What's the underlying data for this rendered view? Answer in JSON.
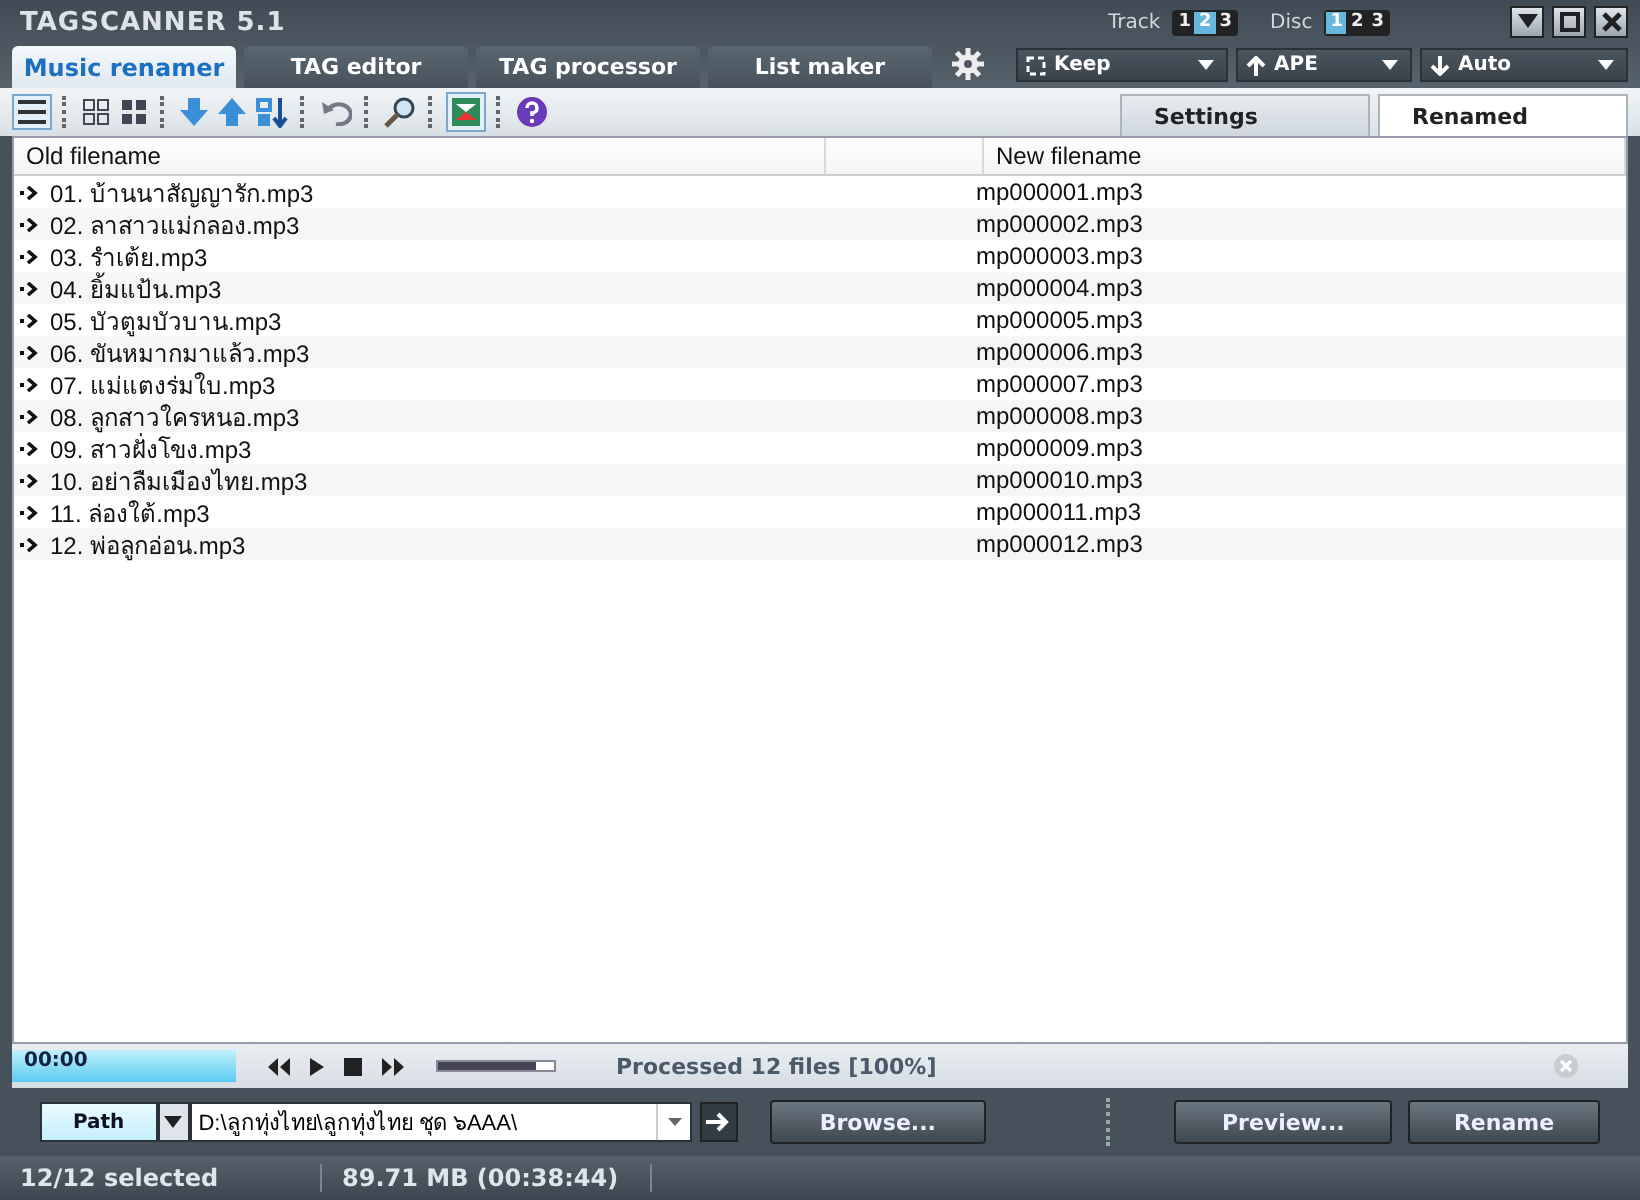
{
  "window": {
    "title": "TAGSCANNER 5.1"
  },
  "tabs": [
    {
      "label": "Music renamer",
      "selected": true
    },
    {
      "label": "TAG editor",
      "selected": false
    },
    {
      "label": "TAG processor",
      "selected": false
    },
    {
      "label": "List maker",
      "selected": false
    }
  ],
  "track": {
    "label": "Track",
    "numbers": [
      {
        "label": "1",
        "selected": false
      },
      {
        "label": "2",
        "selected": true
      },
      {
        "label": "3",
        "selected": false
      }
    ]
  },
  "disc": {
    "label": "Disc",
    "numbers": [
      {
        "label": "1",
        "selected": true
      },
      {
        "label": "2",
        "selected": false
      },
      {
        "label": "3",
        "selected": false
      }
    ]
  },
  "dropdowns": [
    {
      "kind": "keep",
      "value": "Keep"
    },
    {
      "kind": "up",
      "value": "APE"
    },
    {
      "kind": "down",
      "value": "Auto"
    }
  ],
  "panel_tabs": [
    {
      "label": "Settings",
      "selected": false
    },
    {
      "label": "Renamed",
      "selected": true
    }
  ],
  "table": {
    "columns": [
      "Old filename",
      "New filename"
    ],
    "rows": [
      {
        "old": "01. บ้านนาสัญญารัก.mp3",
        "new": "mp000001.mp3"
      },
      {
        "old": "02. ลาสาวแม่กลอง.mp3",
        "new": "mp000002.mp3"
      },
      {
        "old": "03. รำเต้ย.mp3",
        "new": "mp000003.mp3"
      },
      {
        "old": "04. ยิ้มแป้น.mp3",
        "new": "mp000004.mp3"
      },
      {
        "old": "05. บัวตูมบัวบาน.mp3",
        "new": "mp000005.mp3"
      },
      {
        "old": "06. ขันหมากมาแล้ว.mp3",
        "new": "mp000006.mp3"
      },
      {
        "old": "07. แม่แตงร่มใบ.mp3",
        "new": "mp000007.mp3"
      },
      {
        "old": "08. ลูกสาวใครหนอ.mp3",
        "new": "mp000008.mp3"
      },
      {
        "old": "09. สาวฝั่งโขง.mp3",
        "new": "mp000009.mp3"
      },
      {
        "old": "10. อย่าลืมเมืองไทย.mp3",
        "new": "mp000010.mp3"
      },
      {
        "old": "11. ล่องใต้.mp3",
        "new": "mp000011.mp3"
      },
      {
        "old": "12. พ่อลูกอ่อน.mp3",
        "new": "mp000012.mp3"
      }
    ]
  },
  "player": {
    "time": "00:00",
    "volume": {
      "level": 0.85
    },
    "status": "Processed 12 files [100%]"
  },
  "path_bar": {
    "mode": "Path",
    "value": "D:\\ลูกทุ่งไทย\\ลูกทุ่งไทย ชุด ๖AAA\\",
    "buttons": [
      "Browse...",
      "Preview...",
      "Rename"
    ]
  },
  "status_bar": {
    "selection": "12/12 selected",
    "size": "89.71 MB (00:38:44)"
  }
}
